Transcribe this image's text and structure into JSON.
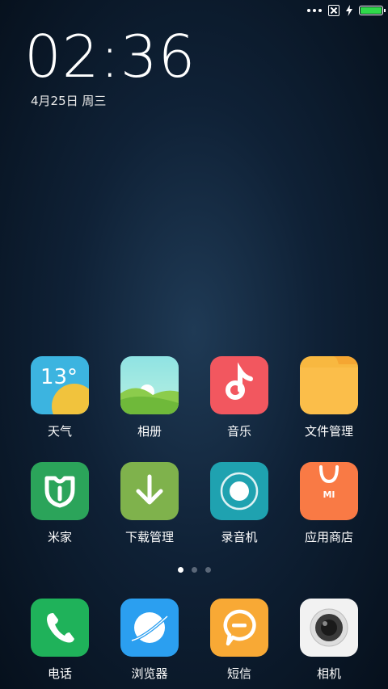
{
  "clock": {
    "time": "02:36",
    "date": "4月25日 周三"
  },
  "status_bar": {
    "battery_level": 1.0,
    "battery_color": "#2fd94a"
  },
  "weather": {
    "temperature": "13°"
  },
  "apps_row1": [
    {
      "label": "天气",
      "icon": "weather-icon"
    },
    {
      "label": "相册",
      "icon": "gallery-icon"
    },
    {
      "label": "音乐",
      "icon": "music-icon"
    },
    {
      "label": "文件管理",
      "icon": "folder-icon"
    }
  ],
  "apps_row2": [
    {
      "label": "米家",
      "icon": "mijia-icon"
    },
    {
      "label": "下载管理",
      "icon": "download-icon"
    },
    {
      "label": "录音机",
      "icon": "recorder-icon"
    },
    {
      "label": "应用商店",
      "icon": "app-store-icon"
    }
  ],
  "dock": [
    {
      "label": "电话",
      "icon": "phone-icon"
    },
    {
      "label": "浏览器",
      "icon": "browser-icon"
    },
    {
      "label": "短信",
      "icon": "messages-icon"
    },
    {
      "label": "相机",
      "icon": "camera-icon"
    }
  ],
  "store_logo_text": "MI",
  "page_indicator": {
    "count": 3,
    "active": 0
  }
}
